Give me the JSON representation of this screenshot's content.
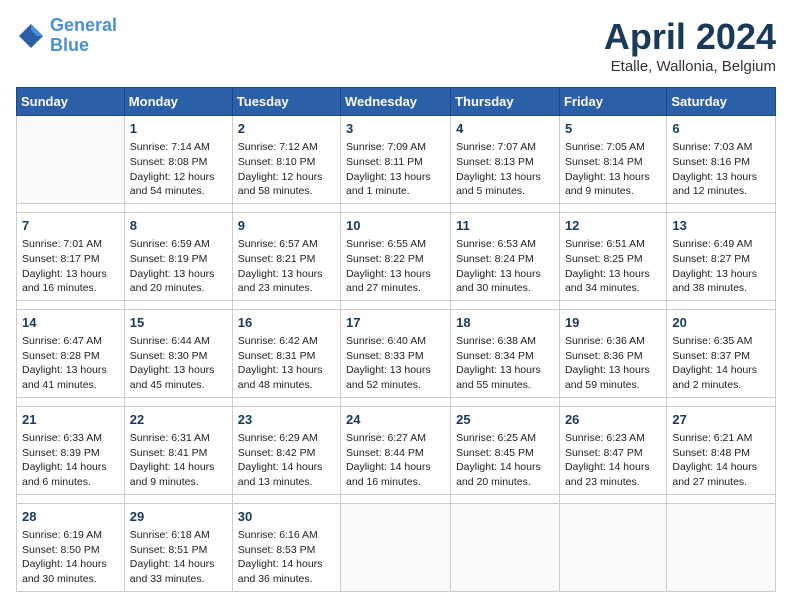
{
  "logo": {
    "line1": "General",
    "line2": "Blue"
  },
  "title": "April 2024",
  "subtitle": "Etalle, Wallonia, Belgium",
  "days_of_week": [
    "Sunday",
    "Monday",
    "Tuesday",
    "Wednesday",
    "Thursday",
    "Friday",
    "Saturday"
  ],
  "weeks": [
    [
      {
        "day": "",
        "info": ""
      },
      {
        "day": "1",
        "info": "Sunrise: 7:14 AM\nSunset: 8:08 PM\nDaylight: 12 hours\nand 54 minutes."
      },
      {
        "day": "2",
        "info": "Sunrise: 7:12 AM\nSunset: 8:10 PM\nDaylight: 12 hours\nand 58 minutes."
      },
      {
        "day": "3",
        "info": "Sunrise: 7:09 AM\nSunset: 8:11 PM\nDaylight: 13 hours\nand 1 minute."
      },
      {
        "day": "4",
        "info": "Sunrise: 7:07 AM\nSunset: 8:13 PM\nDaylight: 13 hours\nand 5 minutes."
      },
      {
        "day": "5",
        "info": "Sunrise: 7:05 AM\nSunset: 8:14 PM\nDaylight: 13 hours\nand 9 minutes."
      },
      {
        "day": "6",
        "info": "Sunrise: 7:03 AM\nSunset: 8:16 PM\nDaylight: 13 hours\nand 12 minutes."
      }
    ],
    [
      {
        "day": "7",
        "info": "Sunrise: 7:01 AM\nSunset: 8:17 PM\nDaylight: 13 hours\nand 16 minutes."
      },
      {
        "day": "8",
        "info": "Sunrise: 6:59 AM\nSunset: 8:19 PM\nDaylight: 13 hours\nand 20 minutes."
      },
      {
        "day": "9",
        "info": "Sunrise: 6:57 AM\nSunset: 8:21 PM\nDaylight: 13 hours\nand 23 minutes."
      },
      {
        "day": "10",
        "info": "Sunrise: 6:55 AM\nSunset: 8:22 PM\nDaylight: 13 hours\nand 27 minutes."
      },
      {
        "day": "11",
        "info": "Sunrise: 6:53 AM\nSunset: 8:24 PM\nDaylight: 13 hours\nand 30 minutes."
      },
      {
        "day": "12",
        "info": "Sunrise: 6:51 AM\nSunset: 8:25 PM\nDaylight: 13 hours\nand 34 minutes."
      },
      {
        "day": "13",
        "info": "Sunrise: 6:49 AM\nSunset: 8:27 PM\nDaylight: 13 hours\nand 38 minutes."
      }
    ],
    [
      {
        "day": "14",
        "info": "Sunrise: 6:47 AM\nSunset: 8:28 PM\nDaylight: 13 hours\nand 41 minutes."
      },
      {
        "day": "15",
        "info": "Sunrise: 6:44 AM\nSunset: 8:30 PM\nDaylight: 13 hours\nand 45 minutes."
      },
      {
        "day": "16",
        "info": "Sunrise: 6:42 AM\nSunset: 8:31 PM\nDaylight: 13 hours\nand 48 minutes."
      },
      {
        "day": "17",
        "info": "Sunrise: 6:40 AM\nSunset: 8:33 PM\nDaylight: 13 hours\nand 52 minutes."
      },
      {
        "day": "18",
        "info": "Sunrise: 6:38 AM\nSunset: 8:34 PM\nDaylight: 13 hours\nand 55 minutes."
      },
      {
        "day": "19",
        "info": "Sunrise: 6:36 AM\nSunset: 8:36 PM\nDaylight: 13 hours\nand 59 minutes."
      },
      {
        "day": "20",
        "info": "Sunrise: 6:35 AM\nSunset: 8:37 PM\nDaylight: 14 hours\nand 2 minutes."
      }
    ],
    [
      {
        "day": "21",
        "info": "Sunrise: 6:33 AM\nSunset: 8:39 PM\nDaylight: 14 hours\nand 6 minutes."
      },
      {
        "day": "22",
        "info": "Sunrise: 6:31 AM\nSunset: 8:41 PM\nDaylight: 14 hours\nand 9 minutes."
      },
      {
        "day": "23",
        "info": "Sunrise: 6:29 AM\nSunset: 8:42 PM\nDaylight: 14 hours\nand 13 minutes."
      },
      {
        "day": "24",
        "info": "Sunrise: 6:27 AM\nSunset: 8:44 PM\nDaylight: 14 hours\nand 16 minutes."
      },
      {
        "day": "25",
        "info": "Sunrise: 6:25 AM\nSunset: 8:45 PM\nDaylight: 14 hours\nand 20 minutes."
      },
      {
        "day": "26",
        "info": "Sunrise: 6:23 AM\nSunset: 8:47 PM\nDaylight: 14 hours\nand 23 minutes."
      },
      {
        "day": "27",
        "info": "Sunrise: 6:21 AM\nSunset: 8:48 PM\nDaylight: 14 hours\nand 27 minutes."
      }
    ],
    [
      {
        "day": "28",
        "info": "Sunrise: 6:19 AM\nSunset: 8:50 PM\nDaylight: 14 hours\nand 30 minutes."
      },
      {
        "day": "29",
        "info": "Sunrise: 6:18 AM\nSunset: 8:51 PM\nDaylight: 14 hours\nand 33 minutes."
      },
      {
        "day": "30",
        "info": "Sunrise: 6:16 AM\nSunset: 8:53 PM\nDaylight: 14 hours\nand 36 minutes."
      },
      {
        "day": "",
        "info": ""
      },
      {
        "day": "",
        "info": ""
      },
      {
        "day": "",
        "info": ""
      },
      {
        "day": "",
        "info": ""
      }
    ]
  ]
}
